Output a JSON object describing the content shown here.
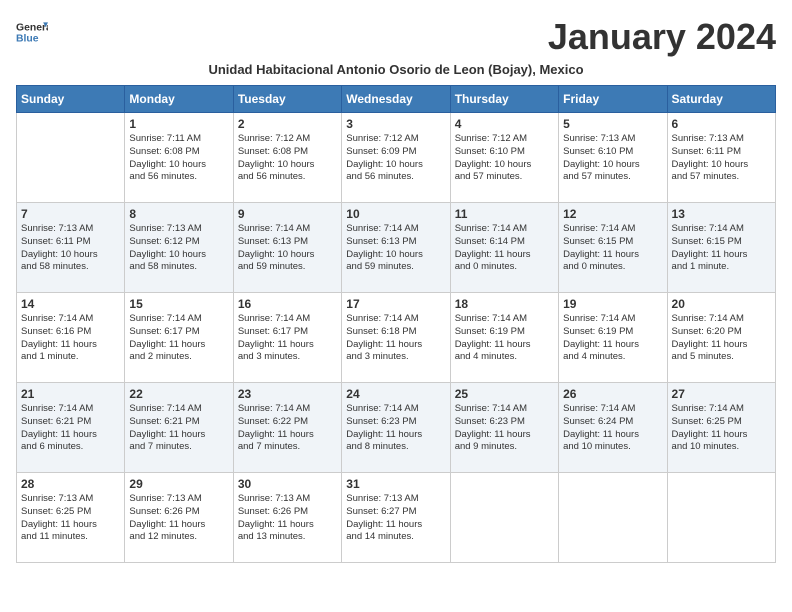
{
  "header": {
    "logo_general": "General",
    "logo_blue": "Blue",
    "month_title": "January 2024",
    "subtitle": "Unidad Habitacional Antonio Osorio de Leon (Bojay), Mexico"
  },
  "days_of_week": [
    "Sunday",
    "Monday",
    "Tuesday",
    "Wednesday",
    "Thursday",
    "Friday",
    "Saturday"
  ],
  "weeks": [
    [
      {
        "day": "",
        "info": ""
      },
      {
        "day": "1",
        "info": "Sunrise: 7:11 AM\nSunset: 6:08 PM\nDaylight: 10 hours\nand 56 minutes."
      },
      {
        "day": "2",
        "info": "Sunrise: 7:12 AM\nSunset: 6:08 PM\nDaylight: 10 hours\nand 56 minutes."
      },
      {
        "day": "3",
        "info": "Sunrise: 7:12 AM\nSunset: 6:09 PM\nDaylight: 10 hours\nand 56 minutes."
      },
      {
        "day": "4",
        "info": "Sunrise: 7:12 AM\nSunset: 6:10 PM\nDaylight: 10 hours\nand 57 minutes."
      },
      {
        "day": "5",
        "info": "Sunrise: 7:13 AM\nSunset: 6:10 PM\nDaylight: 10 hours\nand 57 minutes."
      },
      {
        "day": "6",
        "info": "Sunrise: 7:13 AM\nSunset: 6:11 PM\nDaylight: 10 hours\nand 57 minutes."
      }
    ],
    [
      {
        "day": "7",
        "info": "Sunrise: 7:13 AM\nSunset: 6:11 PM\nDaylight: 10 hours\nand 58 minutes."
      },
      {
        "day": "8",
        "info": "Sunrise: 7:13 AM\nSunset: 6:12 PM\nDaylight: 10 hours\nand 58 minutes."
      },
      {
        "day": "9",
        "info": "Sunrise: 7:14 AM\nSunset: 6:13 PM\nDaylight: 10 hours\nand 59 minutes."
      },
      {
        "day": "10",
        "info": "Sunrise: 7:14 AM\nSunset: 6:13 PM\nDaylight: 10 hours\nand 59 minutes."
      },
      {
        "day": "11",
        "info": "Sunrise: 7:14 AM\nSunset: 6:14 PM\nDaylight: 11 hours\nand 0 minutes."
      },
      {
        "day": "12",
        "info": "Sunrise: 7:14 AM\nSunset: 6:15 PM\nDaylight: 11 hours\nand 0 minutes."
      },
      {
        "day": "13",
        "info": "Sunrise: 7:14 AM\nSunset: 6:15 PM\nDaylight: 11 hours\nand 1 minute."
      }
    ],
    [
      {
        "day": "14",
        "info": "Sunrise: 7:14 AM\nSunset: 6:16 PM\nDaylight: 11 hours\nand 1 minute."
      },
      {
        "day": "15",
        "info": "Sunrise: 7:14 AM\nSunset: 6:17 PM\nDaylight: 11 hours\nand 2 minutes."
      },
      {
        "day": "16",
        "info": "Sunrise: 7:14 AM\nSunset: 6:17 PM\nDaylight: 11 hours\nand 3 minutes."
      },
      {
        "day": "17",
        "info": "Sunrise: 7:14 AM\nSunset: 6:18 PM\nDaylight: 11 hours\nand 3 minutes."
      },
      {
        "day": "18",
        "info": "Sunrise: 7:14 AM\nSunset: 6:19 PM\nDaylight: 11 hours\nand 4 minutes."
      },
      {
        "day": "19",
        "info": "Sunrise: 7:14 AM\nSunset: 6:19 PM\nDaylight: 11 hours\nand 4 minutes."
      },
      {
        "day": "20",
        "info": "Sunrise: 7:14 AM\nSunset: 6:20 PM\nDaylight: 11 hours\nand 5 minutes."
      }
    ],
    [
      {
        "day": "21",
        "info": "Sunrise: 7:14 AM\nSunset: 6:21 PM\nDaylight: 11 hours\nand 6 minutes."
      },
      {
        "day": "22",
        "info": "Sunrise: 7:14 AM\nSunset: 6:21 PM\nDaylight: 11 hours\nand 7 minutes."
      },
      {
        "day": "23",
        "info": "Sunrise: 7:14 AM\nSunset: 6:22 PM\nDaylight: 11 hours\nand 7 minutes."
      },
      {
        "day": "24",
        "info": "Sunrise: 7:14 AM\nSunset: 6:23 PM\nDaylight: 11 hours\nand 8 minutes."
      },
      {
        "day": "25",
        "info": "Sunrise: 7:14 AM\nSunset: 6:23 PM\nDaylight: 11 hours\nand 9 minutes."
      },
      {
        "day": "26",
        "info": "Sunrise: 7:14 AM\nSunset: 6:24 PM\nDaylight: 11 hours\nand 10 minutes."
      },
      {
        "day": "27",
        "info": "Sunrise: 7:14 AM\nSunset: 6:25 PM\nDaylight: 11 hours\nand 10 minutes."
      }
    ],
    [
      {
        "day": "28",
        "info": "Sunrise: 7:13 AM\nSunset: 6:25 PM\nDaylight: 11 hours\nand 11 minutes."
      },
      {
        "day": "29",
        "info": "Sunrise: 7:13 AM\nSunset: 6:26 PM\nDaylight: 11 hours\nand 12 minutes."
      },
      {
        "day": "30",
        "info": "Sunrise: 7:13 AM\nSunset: 6:26 PM\nDaylight: 11 hours\nand 13 minutes."
      },
      {
        "day": "31",
        "info": "Sunrise: 7:13 AM\nSunset: 6:27 PM\nDaylight: 11 hours\nand 14 minutes."
      },
      {
        "day": "",
        "info": ""
      },
      {
        "day": "",
        "info": ""
      },
      {
        "day": "",
        "info": ""
      }
    ]
  ]
}
